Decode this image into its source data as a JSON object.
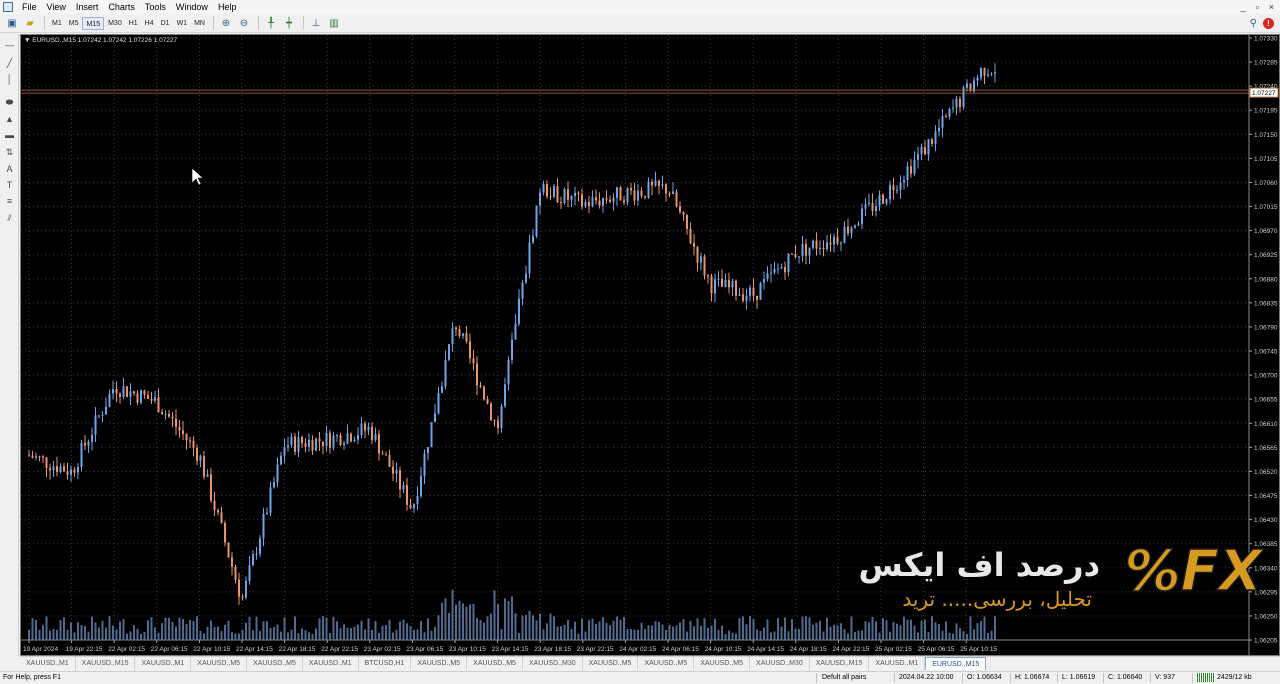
{
  "menu": {
    "items": [
      "File",
      "View",
      "Insert",
      "Charts",
      "Tools",
      "Window",
      "Help"
    ],
    "window_buttons": [
      "_",
      "▫",
      "×"
    ]
  },
  "toolbar": {
    "timeframes": [
      "M1",
      "M5",
      "M15",
      "M30",
      "H1",
      "H4",
      "D1",
      "W1",
      "MN"
    ],
    "active_timeframe": "M15"
  },
  "chart": {
    "header": "▼ EURUSD.,M15  1.07242 1.07242 1.07226 1.07227",
    "current_price": "1.07227",
    "price_labels": [
      "1.07330",
      "1.07285",
      "1.07240",
      "1.07195",
      "1.07150",
      "1.07105",
      "1.07060",
      "1.07015",
      "1.06970",
      "1.06925",
      "1.06880",
      "1.06835",
      "1.06790",
      "1.06745",
      "1.06700",
      "1.06655",
      "1.06610",
      "1.06565",
      "1.06520",
      "1.06475",
      "1.06430",
      "1.06385",
      "1.06340",
      "1.06295",
      "1.06250",
      "1.06205"
    ],
    "time_labels": [
      "19 Apr 2024",
      "19 Apr 22:15",
      "22 Apr 02:15",
      "22 Apr 06:15",
      "22 Apr 10:15",
      "22 Apr 14:15",
      "22 Apr 18:15",
      "22 Apr 22:15",
      "23 Apr 02:15",
      "23 Apr 06:15",
      "23 Apr 10:15",
      "23 Apr 14:15",
      "23 Apr 18:15",
      "23 Apr 22:15",
      "24 Apr 02:15",
      "24 Apr 06:15",
      "24 Apr 10:15",
      "24 Apr 14:15",
      "24 Apr 18:15",
      "24 Apr 22:15",
      "25 Apr 02:15",
      "25 Apr 06:15",
      "25 Apr 10:15"
    ],
    "colors": {
      "bull": "#6fa4e8",
      "bear": "#e8956a",
      "grid": "#3a3a3a",
      "volume": "#5b7fa8",
      "price_line": "#c0703a"
    }
  },
  "chart_data": {
    "type": "candlestick",
    "symbol": "EURUSD.",
    "timeframe": "M15",
    "ylim": [
      1.06205,
      1.0733
    ],
    "close_path": [
      {
        "t": "19 Apr 2024",
        "price": 1.0655
      },
      {
        "t": "19 Apr 22:15",
        "price": 1.0652
      },
      {
        "t": "22 Apr 02:15",
        "price": 1.0668
      },
      {
        "t": "22 Apr 06:15",
        "price": 1.0665
      },
      {
        "t": "22 Apr 10:15",
        "price": 1.0655
      },
      {
        "t": "22 Apr 14:15",
        "price": 1.0628
      },
      {
        "t": "22 Apr 18:15",
        "price": 1.0657
      },
      {
        "t": "22 Apr 22:15",
        "price": 1.0658
      },
      {
        "t": "23 Apr 02:15",
        "price": 1.066
      },
      {
        "t": "23 Apr 06:15",
        "price": 1.0645
      },
      {
        "t": "23 Apr 10:15",
        "price": 1.068
      },
      {
        "t": "23 Apr 14:15",
        "price": 1.066
      },
      {
        "t": "23 Apr 18:15",
        "price": 1.0705
      },
      {
        "t": "23 Apr 22:15",
        "price": 1.0702
      },
      {
        "t": "24 Apr 02:15",
        "price": 1.0704
      },
      {
        "t": "24 Apr 06:15",
        "price": 1.0705
      },
      {
        "t": "24 Apr 10:15",
        "price": 1.0687
      },
      {
        "t": "24 Apr 14:15",
        "price": 1.0685
      },
      {
        "t": "24 Apr 18:15",
        "price": 1.0693
      },
      {
        "t": "24 Apr 22:15",
        "price": 1.0696
      },
      {
        "t": "25 Apr 02:15",
        "price": 1.0703
      },
      {
        "t": "25 Apr 06:15",
        "price": 1.0712
      },
      {
        "t": "25 Apr 10:15",
        "price": 1.0723
      }
    ]
  },
  "tabs": [
    "XAUUSD.,M1",
    "XAUUSD.,M15",
    "XAUUSD.,M1",
    "XAUUSD.,M5",
    "XAUUSD.,M5",
    "XAUUSD.,M1",
    "BTCUSD,H1",
    "XAUUSD.,M5",
    "XAUUSD.,M5",
    "XAUUSD.,M30",
    "XAUUSD.,M5",
    "XAUUSD.,M5",
    "XAUUSD.,M5",
    "XAUUSD.,M30",
    "XAUUSD.,M15",
    "XAUUSD.,M1",
    "EURUSD.,M15"
  ],
  "active_tab": "EURUSD.,M15",
  "status": {
    "help": "For Help, press F1",
    "profile": "Defult all pairs",
    "datetime": "2024.04.22 10:00",
    "open": "O: 1.06634",
    "high": "H: 1.06674",
    "low": "L: 1.06619",
    "close": "C: 1.06640",
    "volume": "V: 937",
    "traffic": "2429/12 kb"
  },
  "watermark": {
    "logo": "%FX",
    "title": "درصد اف ایکس",
    "subtitle": "تحلیل، بررسی..... ترید"
  }
}
